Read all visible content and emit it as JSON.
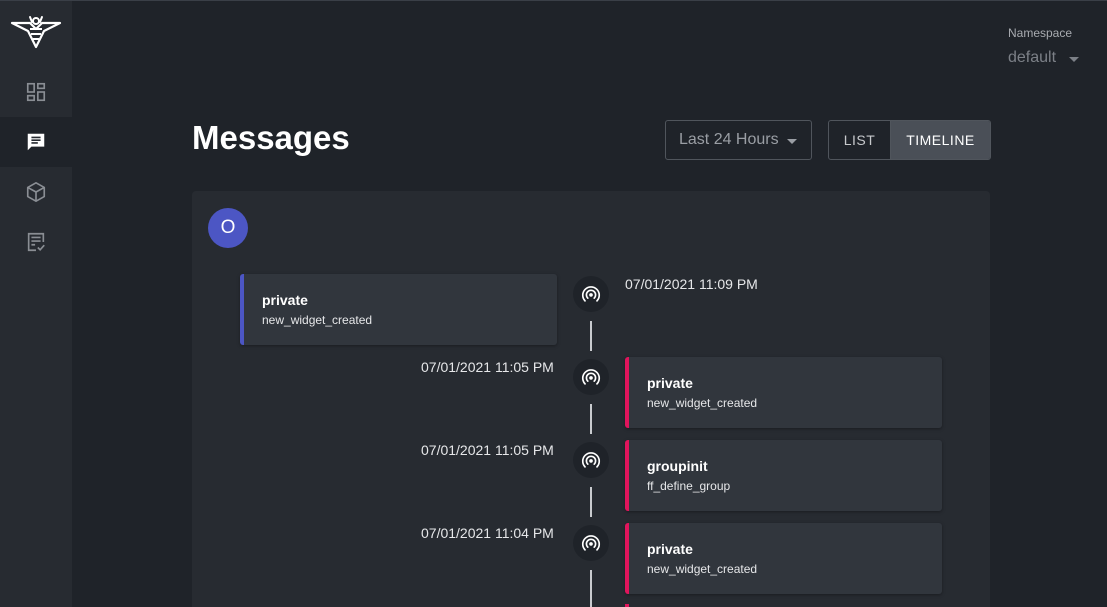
{
  "sidebar": {
    "items": [
      {
        "icon": "dashboard-icon",
        "active": false
      },
      {
        "icon": "messages-icon",
        "active": true
      },
      {
        "icon": "cube-icon",
        "active": false
      },
      {
        "icon": "list-check-icon",
        "active": false
      }
    ]
  },
  "namespace": {
    "label": "Namespace",
    "value": "default"
  },
  "header": {
    "title": "Messages",
    "time_filter": "Last 24 Hours",
    "view_list": "LIST",
    "view_timeline": "TIMELINE",
    "active_view": "TIMELINE"
  },
  "panel": {
    "avatar_letter": "O"
  },
  "timeline": {
    "icon": "broadcast-icon",
    "entries": [
      {
        "side": "left",
        "color": "#4c56c4",
        "topic": "private",
        "tag": "new_widget_created",
        "timestamp": "07/01/2021 11:09 PM"
      },
      {
        "side": "right",
        "color": "#e0155c",
        "topic": "private",
        "tag": "new_widget_created",
        "timestamp": "07/01/2021 11:05 PM"
      },
      {
        "side": "right",
        "color": "#e0155c",
        "topic": "groupinit",
        "tag": "ff_define_group",
        "timestamp": "07/01/2021 11:05 PM"
      },
      {
        "side": "right",
        "color": "#e0155c",
        "topic": "private",
        "tag": "new_widget_created",
        "timestamp": "07/01/2021 11:04 PM"
      }
    ]
  },
  "colors": {
    "background": "#1f2329",
    "sidebar": "#272b31",
    "panel": "#272b31",
    "card": "#31363d",
    "accent_blue": "#4c56c4",
    "accent_pink": "#e0155c"
  }
}
